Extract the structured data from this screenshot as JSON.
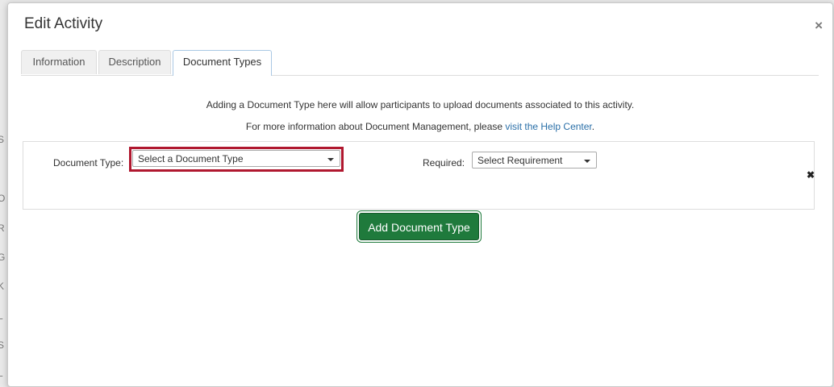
{
  "modal": {
    "title": "Edit Activity",
    "close_icon": "×"
  },
  "tabs": [
    {
      "label": "Information"
    },
    {
      "label": "Description"
    },
    {
      "label": "Document Types",
      "active": true
    }
  ],
  "info": {
    "line1": "Adding a Document Type here will allow participants to upload documents associated to this activity.",
    "line2_prefix": "For more information about Document Management, please ",
    "line2_link": "visit the Help Center",
    "line2_suffix": "."
  },
  "document_row": {
    "type_label": "Document Type:",
    "type_value": "Select a Document Type",
    "required_label": "Required:",
    "required_value": "Select Requirement",
    "remove_icon": "✖"
  },
  "add_button": "Add Document Type",
  "colors": {
    "accent_green": "#1f7a3c",
    "highlight_red": "#b0182f",
    "link_blue": "#2a6fa8"
  }
}
